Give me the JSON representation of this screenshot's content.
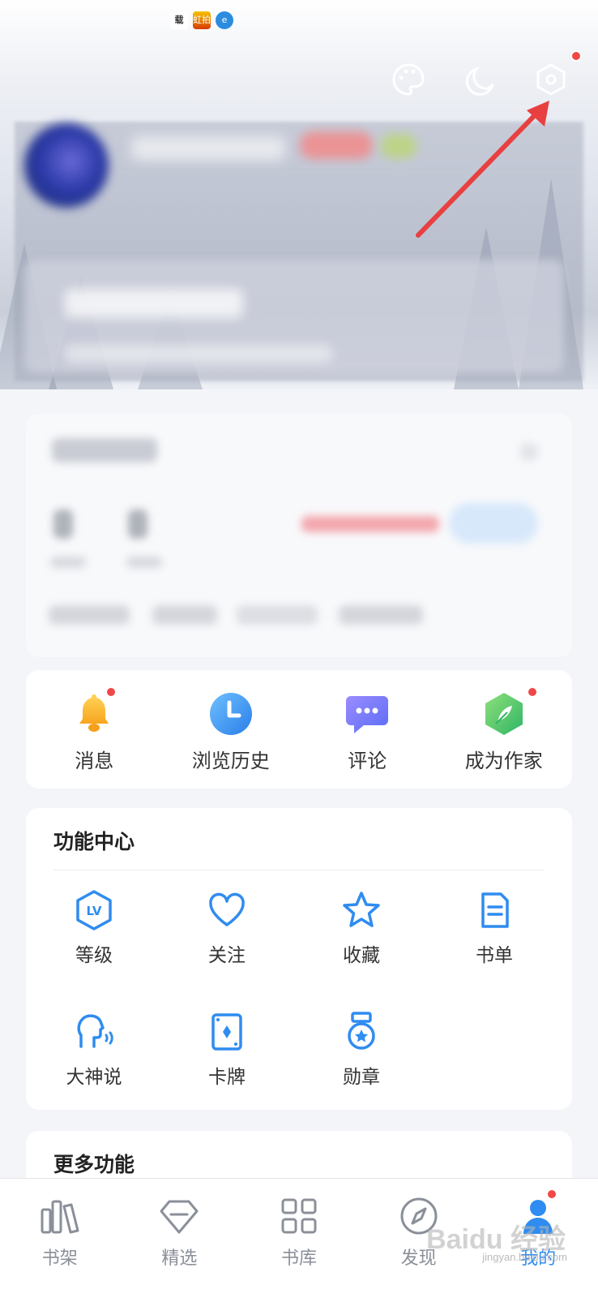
{
  "status_bar": {
    "icon1_text": "载",
    "icon2_text": "虹拍"
  },
  "header": {
    "icons": [
      "palette-icon",
      "moon-icon",
      "settings-hexagon-icon"
    ],
    "settings_has_badge": true
  },
  "quick_actions": [
    {
      "label": "消息",
      "icon": "bell-icon",
      "badge": true
    },
    {
      "label": "浏览历史",
      "icon": "clock-icon",
      "badge": false
    },
    {
      "label": "评论",
      "icon": "chat-icon",
      "badge": false
    },
    {
      "label": "成为作家",
      "icon": "feather-icon",
      "badge": true
    }
  ],
  "function_center": {
    "title": "功能中心",
    "items": [
      {
        "label": "等级",
        "icon": "level-lv-icon"
      },
      {
        "label": "关注",
        "icon": "heart-icon"
      },
      {
        "label": "收藏",
        "icon": "star-icon"
      },
      {
        "label": "书单",
        "icon": "booklist-icon"
      },
      {
        "label": "大神说",
        "icon": "speaking-head-icon"
      },
      {
        "label": "卡牌",
        "icon": "card-icon"
      },
      {
        "label": "勋章",
        "icon": "medal-icon"
      }
    ]
  },
  "more_functions": {
    "title": "更多功能"
  },
  "bottom_nav": [
    {
      "label": "书架",
      "icon": "bookshelf-icon",
      "active": false
    },
    {
      "label": "精选",
      "icon": "diamond-icon",
      "active": false
    },
    {
      "label": "书库",
      "icon": "grid-icon",
      "active": false
    },
    {
      "label": "发现",
      "icon": "compass-icon",
      "active": false
    },
    {
      "label": "我的",
      "icon": "profile-icon",
      "active": true,
      "badge": true
    }
  ],
  "watermark": {
    "brand": "Baidu 经验",
    "url": "jingyan.baidu.com"
  },
  "colors": {
    "accent": "#2f8cf0",
    "badge_red": "#f04848",
    "icon_blue": "#2f8cf0"
  }
}
